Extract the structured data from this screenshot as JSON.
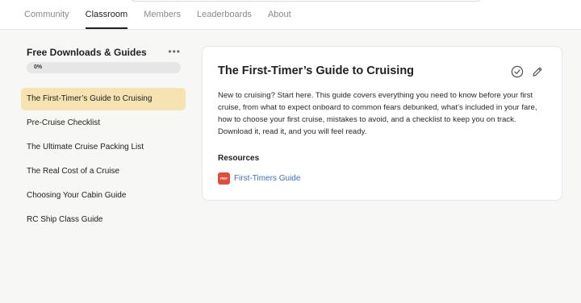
{
  "nav": {
    "tabs": [
      {
        "label": "Community",
        "active": false
      },
      {
        "label": "Classroom",
        "active": true
      },
      {
        "label": "Members",
        "active": false
      },
      {
        "label": "Leaderboards",
        "active": false
      },
      {
        "label": "About",
        "active": false
      }
    ]
  },
  "sidebar": {
    "title": "Free Downloads & Guides",
    "more_icon": "more-horizontal-icon",
    "progress": {
      "value": 0,
      "label": "0%"
    },
    "lessons": [
      {
        "label": "The First-Timer’s Guide to Cruising",
        "active": true
      },
      {
        "label": "Pre-Cruise Checklist",
        "active": false
      },
      {
        "label": "The Ultimate Cruise Packing List",
        "active": false
      },
      {
        "label": "The Real Cost of a Cruise",
        "active": false
      },
      {
        "label": "Choosing Your Cabin Guide",
        "active": false
      },
      {
        "label": "RC Ship Class Guide",
        "active": false
      }
    ]
  },
  "lesson": {
    "title": "The First-Timer’s Guide to Cruising",
    "description": "New to cruising? Start here. This guide covers everything you need to know before your first cruise, from what to expect onboard to common fears debunked, what’s included in your fare, how to choose your first cruise, mistakes to avoid, and a checklist to keep you on track. Download it, read it, and you will feel ready.",
    "actions": {
      "complete_icon": "check-circle-icon",
      "edit_icon": "pencil-icon"
    },
    "resources_heading": "Resources",
    "resources": [
      {
        "icon_label": "PDF",
        "label": "First-Timers Guide"
      }
    ]
  },
  "colors": {
    "active_lesson_bg": "#f7e3b1",
    "link": "#3a6fc4",
    "pdf_badge": "#e24c3a",
    "page_bg": "#f7f7f5"
  }
}
